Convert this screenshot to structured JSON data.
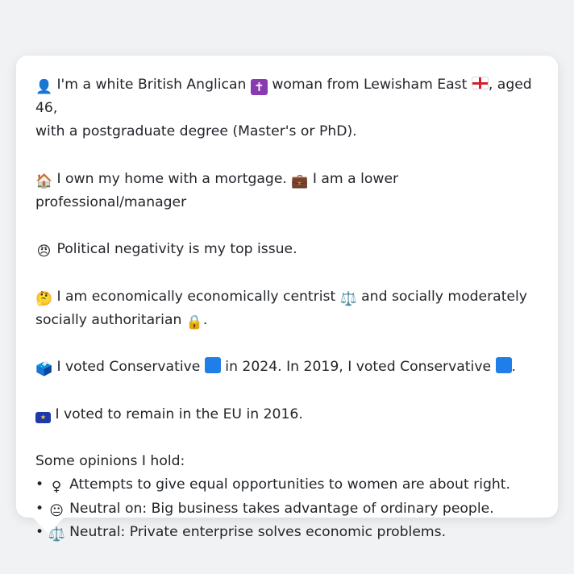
{
  "profile": {
    "line1_a": "I'm a white British Anglican",
    "line1_b": "woman from Lewisham East",
    "line1_c": ", aged 46,",
    "line2": "with a postgraduate degree (Master's or PhD).",
    "home_a": "I own my home with a mortgage.",
    "home_b": "I am a lower professional/manager",
    "issue": "Political negativity is my top issue.",
    "econ_a": "I am economically economically centrist",
    "econ_b": "and socially moderately",
    "econ_c": "socially authoritarian",
    "econ_d": ".",
    "vote_a": "I voted Conservative",
    "vote_b": "in 2024. In 2019, I voted Conservative",
    "vote_c": ".",
    "eu": "I voted to remain in the EU in 2016.",
    "opinions_heading": "Some opinions I hold:",
    "opinions": [
      {
        "bullet": "•",
        "icon": "♀",
        "text": " Attempts to give equal opportunities to women are about right."
      },
      {
        "bullet": "•",
        "icon": "😐",
        "text": " Neutral on: Big business takes advantage of ordinary people."
      },
      {
        "bullet": "•",
        "icon": "⚖️",
        "text": " Neutral: Private enterprise solves economic problems."
      }
    ]
  },
  "icons": {
    "person": "👤",
    "cross": "✝",
    "house": "🏠",
    "briefcase": "💼",
    "angry": "😠",
    "thinking": "🤔",
    "scales": "⚖️",
    "lock": "🔒",
    "ballot": "🗳️",
    "eu_stars": "★"
  },
  "colors": {
    "page_bg": "#f1f2f4",
    "card_bg": "#ffffff",
    "text": "#22252a",
    "conservative_blue": "#1f7ee8",
    "cross_purple": "#8a3ab0"
  }
}
